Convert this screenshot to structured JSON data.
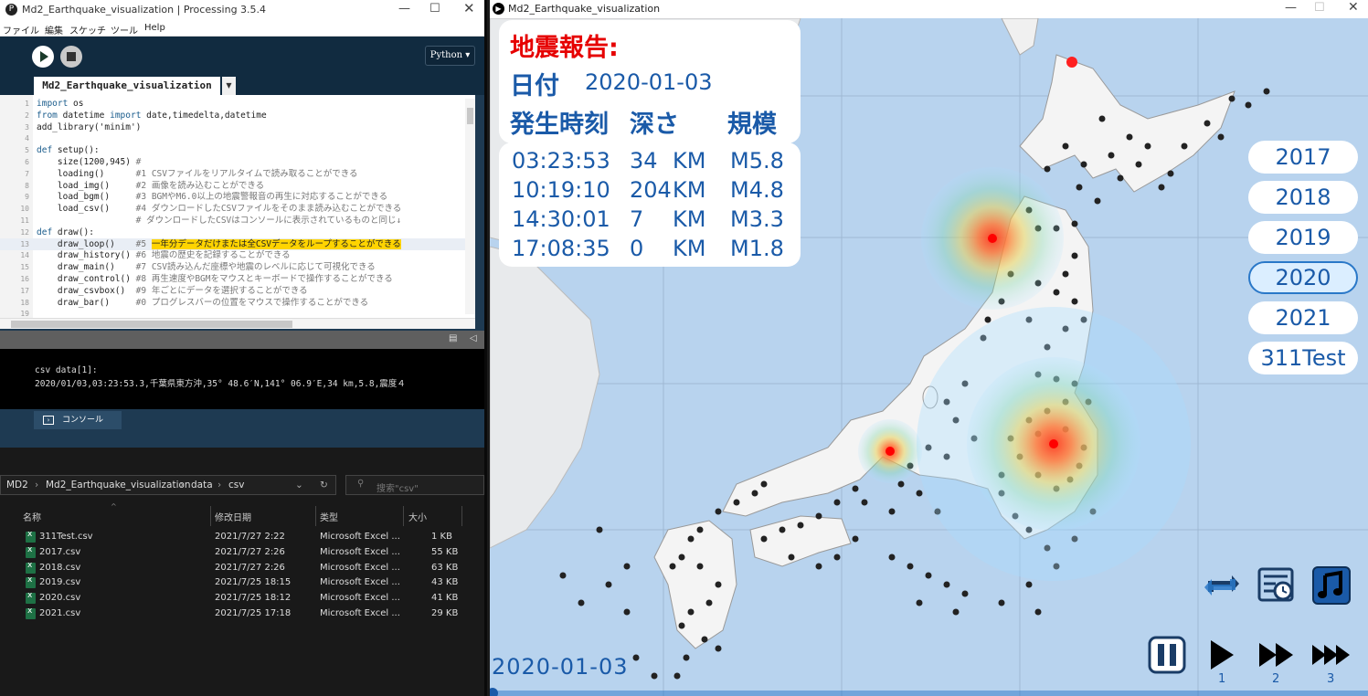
{
  "ide": {
    "window_title": "Md2_Earthquake_visualization | Processing 3.5.4",
    "menu": [
      "ファイル",
      "編集",
      "スケッチ",
      "ツール",
      "Help"
    ],
    "mode": "Python ▾",
    "tab_name": "Md2_Earthquake_visualization",
    "code_lines": [
      {
        "n": "1",
        "text": "import os"
      },
      {
        "n": "2",
        "text": "from datetime import date,timedelta,datetime"
      },
      {
        "n": "3",
        "text": "add_library('minim')"
      },
      {
        "n": "4",
        "text": ""
      },
      {
        "n": "5",
        "text": "def setup():"
      },
      {
        "n": "6",
        "text": "    size(1200,945) #"
      },
      {
        "n": "7",
        "text": "    loading()      #1 CSVファイルをリアルタイムで読み取ることができる"
      },
      {
        "n": "8",
        "text": "    load_img()     #2 画像を読み込むことができる"
      },
      {
        "n": "9",
        "text": "    load_bgm()     #3 BGMやM6.0以上の地震警報音の再生に対応することができる"
      },
      {
        "n": "10",
        "text": "    load_csv()     #4 ダウンロードしたCSVファイルをそのまま読み込むことができる"
      },
      {
        "n": "11",
        "text": "                   # ダウンロードしたCSVはコンソールに表示されているものと同じ↓"
      },
      {
        "n": "12",
        "text": "def draw():"
      },
      {
        "n": "13",
        "text": "    draw_loop()    #5 "
      },
      {
        "n": "14",
        "text": "    draw_history() #6 地震の歴史を記録することができる"
      },
      {
        "n": "15",
        "text": "    draw_main()    #7 CSV読み込んだ座標や地震のレベルに応じて可視化できる"
      },
      {
        "n": "16",
        "text": "    draw_control() #8 再生速度やBGMをマウスとキーボードで操作することができる"
      },
      {
        "n": "17",
        "text": "    draw_csvbox()  #9 年ごとにデータを選択することができる"
      },
      {
        "n": "18",
        "text": "    draw_bar()     #0 プログレスバーの位置をマウスで操作することができる"
      },
      {
        "n": "19",
        "text": ""
      }
    ],
    "highlight_text": "一年分データだけまたは全CSVデータをループすることができる",
    "console_lines": [
      "csv data[1]:",
      "2020/01/03,03:23:53.3,千葉県東方沖,35° 48.6′N,141° 06.9′E,34 km,5.8,震度４"
    ],
    "console_tab": "コンソール"
  },
  "explorer": {
    "breadcrumb": [
      "MD2",
      "Md2_Earthquake_visualization",
      "data",
      "csv"
    ],
    "search_placeholder": "搜索\"csv\"",
    "columns": [
      "名称",
      "修改日期",
      "类型",
      "大小"
    ],
    "files": [
      {
        "name": "311Test.csv",
        "date": "2021/7/27 2:22",
        "type": "Microsoft Excel ...",
        "size": "1 KB"
      },
      {
        "name": "2017.csv",
        "date": "2021/7/27 2:26",
        "type": "Microsoft Excel ...",
        "size": "55 KB"
      },
      {
        "name": "2018.csv",
        "date": "2021/7/27 2:26",
        "type": "Microsoft Excel ...",
        "size": "63 KB"
      },
      {
        "name": "2019.csv",
        "date": "2021/7/25 18:15",
        "type": "Microsoft Excel ...",
        "size": "43 KB"
      },
      {
        "name": "2020.csv",
        "date": "2021/7/25 18:12",
        "type": "Microsoft Excel ...",
        "size": "41 KB"
      },
      {
        "name": "2021.csv",
        "date": "2021/7/25 17:18",
        "type": "Microsoft Excel ...",
        "size": "29 KB"
      }
    ]
  },
  "viz": {
    "window_title": "Md2_Earthquake_visualization",
    "report_title": "地震報告:",
    "date_label": "日付",
    "date_value": "2020-01-03",
    "col_time": "発生時刻",
    "col_depth": "深さ",
    "col_scale": "規模",
    "quakes": [
      {
        "time": "03:23:53",
        "depth": "34",
        "unit": "KM",
        "mag": "M5.8"
      },
      {
        "time": "10:19:10",
        "depth": "204",
        "unit": "KM",
        "mag": "M4.8"
      },
      {
        "time": "14:30:01",
        "depth": "7",
        "unit": "KM",
        "mag": "M3.3"
      },
      {
        "time": "17:08:35",
        "depth": "0",
        "unit": "KM",
        "mag": "M1.8"
      }
    ],
    "years": [
      "2017",
      "2018",
      "2019",
      "2020",
      "2021",
      "311Test"
    ],
    "selected_year": "2020",
    "speed_labels": [
      "1",
      "2",
      "3"
    ],
    "bottom_date": "2020-01-03",
    "colors": {
      "title_red": "#e60000",
      "text_blue": "#1a5aa8",
      "sea": "#b8d3ee",
      "land": "#f4f4f4"
    }
  }
}
